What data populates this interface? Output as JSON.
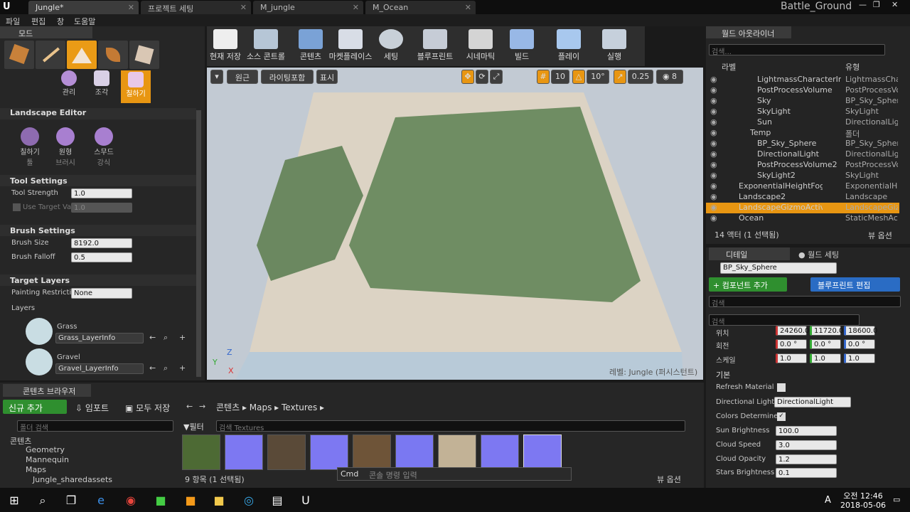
{
  "tabs": [
    "Jungle*",
    "프로젝트 세팅",
    "M_jungle",
    "M_Ocean"
  ],
  "project": "Battle_Ground",
  "menu": [
    "파일",
    "편집",
    "창",
    "도움말"
  ],
  "modes": {
    "title": "모드",
    "sub": [
      "관리",
      "조각",
      "칠하기"
    ]
  },
  "landscape": {
    "title": "Landscape Editor",
    "tools": [
      "칠하기",
      "원형",
      "스무드"
    ],
    "toolsSub": [
      "툴",
      "브러시",
      "강식"
    ]
  },
  "tool_settings": {
    "title": "Tool Settings",
    "strength_label": "Tool Strength",
    "strength": "1.0",
    "use_target_label": "Use Target Val",
    "use_target": "1.0"
  },
  "brush": {
    "title": "Brush Settings",
    "size_label": "Brush Size",
    "size": "8192.0",
    "falloff_label": "Brush Falloff",
    "falloff": "0.5"
  },
  "target": {
    "title": "Target Layers",
    "restrict_label": "Painting Restrictic",
    "restrict": "None",
    "layers_label": "Layers",
    "layers": [
      {
        "name": "Grass",
        "info": "Grass_LayerInfo"
      },
      {
        "name": "Gravel",
        "info": "Gravel_LayerInfo"
      }
    ]
  },
  "toolbar": [
    "현재 저장",
    "소스 콘트롤",
    "콘텐츠",
    "마켓플레이스",
    "세팅",
    "블루프린트",
    "시네마틱",
    "빌드",
    "플레이",
    "실행"
  ],
  "viewport": {
    "persp": "원근",
    "lit": "라이팅포함",
    "show": "표시",
    "grid": "10",
    "angle": "10°",
    "scale": "0.25",
    "cam": "8",
    "level": "레벨:  Jungle (퍼시스턴트)"
  },
  "outliner": {
    "title": "월드 아웃라이너",
    "search": "검색...",
    "col1": "라벨",
    "col2": "유형",
    "rows": [
      {
        "label": "LightmassCharacterIndire",
        "type": "LightmassChar"
      },
      {
        "label": "PostProcessVolume",
        "type": "PostProcessVo"
      },
      {
        "label": "Sky",
        "type": "BP_Sky_Spher"
      },
      {
        "label": "SkyLight",
        "type": "SkyLight"
      },
      {
        "label": "Sun",
        "type": "DirectionalLigh"
      },
      {
        "label": "Temp",
        "type": "폴더"
      },
      {
        "label": "BP_Sky_Sphere",
        "type": "BP_Sky_Spher"
      },
      {
        "label": "DirectionalLight",
        "type": "DirectionalLigh"
      },
      {
        "label": "PostProcessVolume2",
        "type": "PostProcessVo"
      },
      {
        "label": "SkyLight2",
        "type": "SkyLight"
      },
      {
        "label": "ExponentialHeightFog",
        "type": "ExponentialHei"
      },
      {
        "label": "Landscape2",
        "type": "Landscape"
      },
      {
        "label": "LandscapeGizmoActiveActo",
        "type": "LandscapeGizn"
      },
      {
        "label": "Ocean",
        "type": "StaticMeshActo"
      }
    ],
    "count": "14 액터 (1 선택됨)",
    "view": "뷰 옵션"
  },
  "details": {
    "tab1": "디테일",
    "tab2": "월드 세팅",
    "actor": "BP_Sky_Sphere",
    "add": "+ 컴포넌트 추가",
    "bp": "블루프린트 편집",
    "search": "검색",
    "search2": "검색",
    "loc_label": "위치",
    "loc": [
      "24260.0",
      "11720.0",
      "18600.0"
    ],
    "rot_label": "회전",
    "rot": [
      "0.0 °",
      "0.0 °",
      "0.0 °"
    ],
    "scale_label": "스케일",
    "scale": [
      "1.0",
      "1.0",
      "1.0"
    ],
    "section": "기본",
    "refresh": "Refresh Material",
    "dirlight_label": "Directional Light A",
    "dirlight": "DirectionalLight",
    "colors": "Colors Determined",
    "sun_label": "Sun Brightness",
    "sun": "100.0",
    "cloud_speed_label": "Cloud Speed",
    "cloud_speed": "3.0",
    "cloud_op_label": "Cloud Opacity",
    "cloud_op": "1.2",
    "stars_label": "Stars Brightness",
    "stars": "0.1"
  },
  "content": {
    "title": "콘텐츠 브라우저",
    "new": "신규 추가",
    "import": "임포트",
    "saveall": "모두 저장",
    "path": [
      "콘텐츠",
      "Maps",
      "Textures"
    ],
    "folder_search": "폴더 검색",
    "filter": "필터",
    "search": "검색 Textures",
    "tree": [
      "콘텐츠",
      "Geometry",
      "Mannequin",
      "Maps",
      "Jungle_sharedassets"
    ],
    "count": "9 항목 (1 선택됨)",
    "view": "뷰 옵션",
    "cmd": "Cmd",
    "cmd_ph": "콘솔 명령 입력"
  },
  "taskbar": {
    "time": "오전 12:46",
    "date": "2018-05-06",
    "ime": "A"
  }
}
